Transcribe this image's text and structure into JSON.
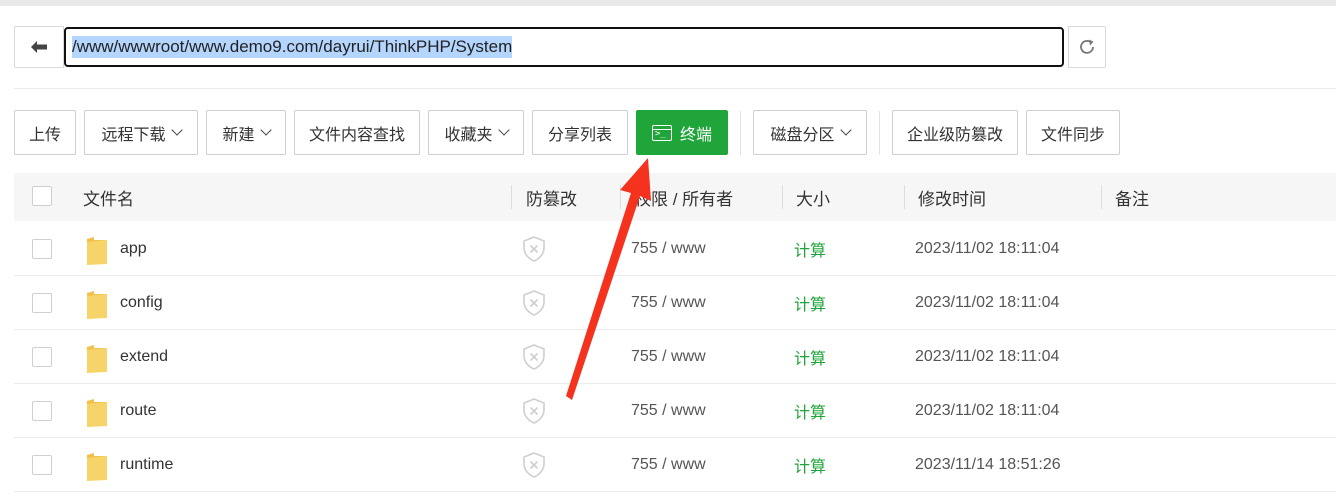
{
  "path_bar": {
    "path": "/www/wwwroot/www.demo9.com/dayrui/ThinkPHP/System"
  },
  "toolbar": {
    "upload": "上传",
    "remote_download": "远程下载",
    "new": "新建",
    "content_search": "文件内容查找",
    "favorites": "收藏夹",
    "share_list": "分享列表",
    "terminal": "终端",
    "disk_partition": "磁盘分区",
    "tamper_proof_enterprise": "企业级防篡改",
    "file_sync": "文件同步"
  },
  "table": {
    "headers": {
      "name": "文件名",
      "tamper": "防篡改",
      "perm_owner": "权限 / 所有者",
      "size": "大小",
      "modified": "修改时间",
      "remark": "备注"
    },
    "rows": [
      {
        "name": "app",
        "perm": "755 / www",
        "size": "计算",
        "modified": "2023/11/02 18:11:04"
      },
      {
        "name": "config",
        "perm": "755 / www",
        "size": "计算",
        "modified": "2023/11/02 18:11:04"
      },
      {
        "name": "extend",
        "perm": "755 / www",
        "size": "计算",
        "modified": "2023/11/02 18:11:04"
      },
      {
        "name": "route",
        "perm": "755 / www",
        "size": "计算",
        "modified": "2023/11/02 18:11:04"
      },
      {
        "name": "runtime",
        "perm": "755 / www",
        "size": "计算",
        "modified": "2023/11/14 18:51:26"
      }
    ]
  },
  "colors": {
    "accent_green": "#20a53a",
    "annotation_arrow": "#f5321e",
    "folder_yellow": "#f7cf5a"
  }
}
